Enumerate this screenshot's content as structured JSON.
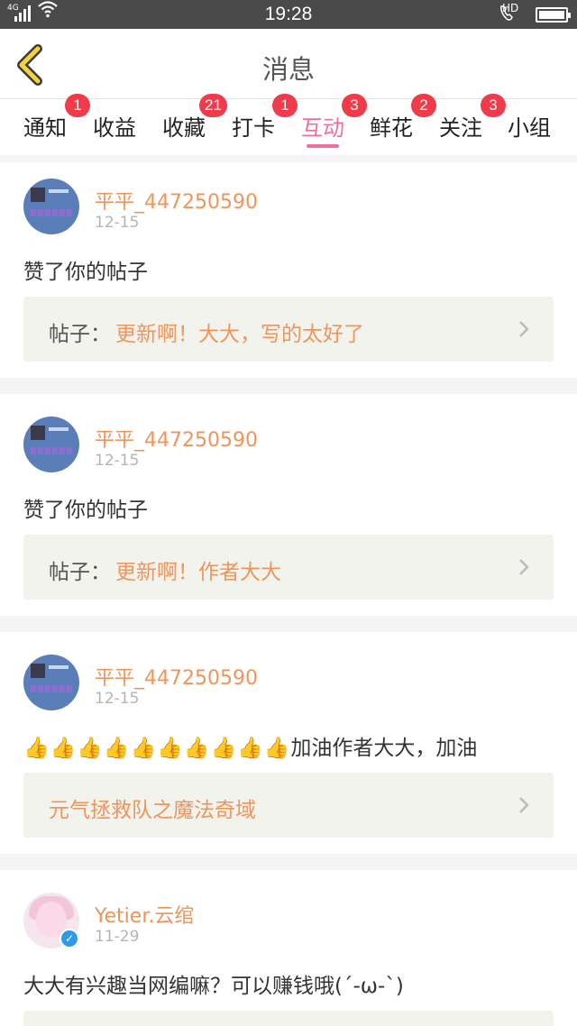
{
  "status_bar": {
    "network": "4G",
    "time": "19:28",
    "hd": "HD"
  },
  "header": {
    "title": "消息",
    "back_icon": "back-chevron-icon",
    "accent": "#f0709a"
  },
  "tabs": [
    {
      "label": "通知",
      "badge": "1"
    },
    {
      "label": "收益",
      "badge": ""
    },
    {
      "label": "收藏",
      "badge": "21"
    },
    {
      "label": "打卡",
      "badge": "1"
    },
    {
      "label": "互动",
      "badge": "3",
      "active": true
    },
    {
      "label": "鲜花",
      "badge": "2"
    },
    {
      "label": "关注",
      "badge": "3"
    },
    {
      "label": "小组",
      "badge": ""
    }
  ],
  "messages": [
    {
      "user": "平平_447250590",
      "date": "12-15",
      "content": "赞了你的帖子",
      "ref_prefix": "帖子：",
      "ref_text": "更新啊！大大，写的太好了"
    },
    {
      "user": "平平_447250590",
      "date": "12-15",
      "content": "赞了你的帖子",
      "ref_prefix": "帖子：",
      "ref_text": "更新啊！作者大大"
    },
    {
      "user": "平平_447250590",
      "date": "12-15",
      "content_emoji": "👍👍👍👍👍👍👍👍👍👍",
      "content": "加油作者大大，加油",
      "ref_prefix": "",
      "ref_text": "元气拯救队之魔法奇域"
    },
    {
      "user": "Yetier.云绾",
      "date": "11-29",
      "content": "大大有兴趣当网编嘛？可以赚钱哦(´-ω-`)",
      "verified": true
    }
  ]
}
